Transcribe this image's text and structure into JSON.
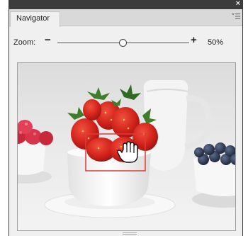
{
  "panel": {
    "close_glyph": "×",
    "tab_label": "Navigator",
    "menu_icon": "panel-menu-icon"
  },
  "zoom": {
    "label": "Zoom:",
    "minus": "−",
    "plus": "+",
    "value_text": "50%",
    "slider_fraction": 0.5
  },
  "preview": {
    "image_subject": "bowl of strawberries with white jug, raspberries and blueberries",
    "view_rect_color": "#e23a36",
    "cursor_icon": "hand-grab-cursor-icon"
  }
}
